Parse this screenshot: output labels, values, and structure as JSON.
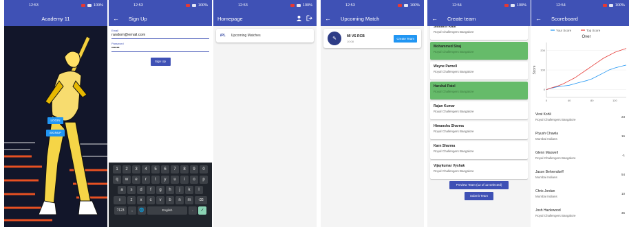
{
  "screens": {
    "academy": {
      "status_time": "12:53",
      "battery": "100%",
      "title": "Academy 11",
      "login_label": "LOGIN",
      "signup_label": "SIGNUP"
    },
    "signup": {
      "status_time": "12:53",
      "battery": "100%",
      "title": "Sign Up",
      "email_label": "Email",
      "email_value": "random@email.com",
      "password_label": "Password",
      "password_value": "••••••",
      "button_label": "Sign Up",
      "keyboard": {
        "row1": [
          "1",
          "2",
          "3",
          "4",
          "5",
          "6",
          "7",
          "8",
          "9",
          "0"
        ],
        "row2": [
          "q",
          "w",
          "e",
          "r",
          "t",
          "y",
          "u",
          "i",
          "o",
          "p"
        ],
        "row3": [
          "a",
          "s",
          "d",
          "f",
          "g",
          "h",
          "j",
          "k",
          "l"
        ],
        "row4": [
          "⇧",
          "z",
          "x",
          "c",
          "v",
          "b",
          "n",
          "m",
          "⌫"
        ],
        "row5": [
          "?123",
          ",",
          "🌐",
          "English",
          ".",
          "✓"
        ]
      }
    },
    "homepage": {
      "status_time": "12:53",
      "battery": "100%",
      "title": "Homepage",
      "logo_text": "IPL",
      "item_label": "Upcoming Matches"
    },
    "upcoming": {
      "status_time": "12:53",
      "battery": "100%",
      "title": "Upcoming Match",
      "teams": "MI  VS  RCB",
      "match_time": "10:08",
      "create_label": "Create Team"
    },
    "create_team": {
      "status_time": "12:54",
      "battery": "100%",
      "title": "Create team",
      "players": [
        {
          "name": "Siddarth Kaul",
          "team": "Royal Challengers Bangalore",
          "selected": false
        },
        {
          "name": "Mohammed Siraj",
          "team": "Royal Challengers Bangalore",
          "selected": true
        },
        {
          "name": "Wayne Parnell",
          "team": "Royal Challengers Bangalore",
          "selected": false
        },
        {
          "name": "Harshal Patel",
          "team": "Royal Challengers Bangalore",
          "selected": true
        },
        {
          "name": "Rajan Kumar",
          "team": "Royal Challengers Bangalore",
          "selected": false
        },
        {
          "name": "Himanshu Sharma",
          "team": "Royal Challengers Bangalore",
          "selected": false
        },
        {
          "name": "Karn Sharma",
          "team": "Royal Challengers Bangalore",
          "selected": false
        },
        {
          "name": "Vijaykumar Vyshak",
          "team": "Royal Challengers Bangalore",
          "selected": false
        }
      ],
      "preview_label": "Preview Team (12 of 12 selected)",
      "submit_label": "Submit Team"
    },
    "scoreboard": {
      "status_time": "12:54",
      "battery": "100%",
      "title": "Scoreboard",
      "rows": [
        {
          "name": "Virat Kohli",
          "team": "Royal Challengers Bangalore",
          "score": "23"
        },
        {
          "name": "Piyush Chawla",
          "team": "Mumbai Indians",
          "score": "16"
        },
        {
          "name": "Glenn Maxwell",
          "team": "Royal Challengers Bangalore",
          "score": "-1"
        },
        {
          "name": "Jason Behrendorff",
          "team": "Mumbai Indians",
          "score": "54"
        },
        {
          "name": "Chris Jordan",
          "team": "Mumbai Indians",
          "score": "10"
        },
        {
          "name": "Josh Hazlewood",
          "team": "Royal Challengers Bangalore",
          "score": "36"
        }
      ]
    }
  },
  "chart_data": {
    "type": "line",
    "title": "Over",
    "xlabel": "",
    "ylabel": "Score",
    "xlim": [
      0,
      140
    ],
    "ylim": [
      -40,
      240
    ],
    "x_ticks": [
      "0",
      "40",
      "80",
      "120"
    ],
    "y_ticks": [
      "200",
      "100",
      "0"
    ],
    "legend_position": "top",
    "series": [
      {
        "name": "Your Score",
        "color": "#2196f3",
        "x": [
          0,
          10,
          20,
          30,
          40,
          50,
          60,
          70,
          80,
          90,
          100,
          110,
          120,
          130,
          140
        ],
        "y": [
          0,
          8,
          15,
          18,
          22,
          30,
          38,
          45,
          55,
          70,
          85,
          100,
          110,
          118,
          125
        ]
      },
      {
        "name": "Top Score",
        "color": "#e53935",
        "x": [
          0,
          10,
          20,
          30,
          40,
          50,
          60,
          70,
          80,
          90,
          100,
          110,
          120,
          130,
          140
        ],
        "y": [
          0,
          10,
          18,
          30,
          45,
          60,
          80,
          100,
          120,
          140,
          160,
          175,
          190,
          200,
          210
        ]
      }
    ]
  }
}
